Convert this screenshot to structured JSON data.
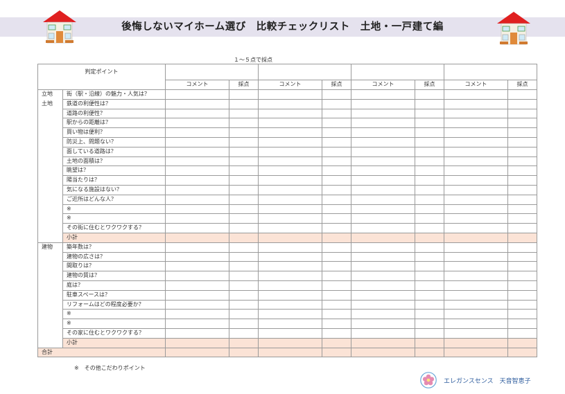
{
  "header": {
    "title": "後悔しないマイホーム選び　比較チェックリスト　土地・一戸建て編",
    "scoring_note": "１～５点で採点"
  },
  "table": {
    "judgment_header": "判定ポイント",
    "candidates": [
      {
        "comment_label": "コメント",
        "score_label": "採点"
      },
      {
        "comment_label": "コメント",
        "score_label": "採点"
      },
      {
        "comment_label": "コメント",
        "score_label": "採点"
      },
      {
        "comment_label": "コメント",
        "score_label": "採点"
      }
    ],
    "sections": [
      {
        "category_lines": [
          "立地",
          "土地"
        ],
        "items": [
          "街（駅・沿線）の魅力・人気は？",
          "鉄道の利便性は？",
          "道路の利便性？",
          "駅からの距離は？",
          "買い物は便利？",
          "防災上、問題ない？",
          "面している道路は？",
          "土地の面積は？",
          "眺望は？",
          "陽当たりは？",
          "気になる施設はない？",
          "ご近所はどんな人？",
          "※",
          "※",
          "その街に住むとワクワクする？"
        ],
        "subtotal_label": "小計"
      },
      {
        "category_lines": [
          "建物"
        ],
        "items": [
          "築年数は？",
          "建物の広さは？",
          "間取りは？",
          "建物の質は？",
          "庭は？",
          "駐車スペースは？",
          "リフォームはどの程度必要か？",
          "※",
          "※",
          "その家に住むとワクワクする？"
        ],
        "subtotal_label": "小計"
      }
    ],
    "total_label": "合計"
  },
  "footnote": "※　その他こだわりポイント",
  "brand": {
    "name": "エレガンスセンス　天音智恵子",
    "icon": "flower-icon"
  },
  "icons": {
    "left": "house-icon",
    "right": "house-icon"
  },
  "colors": {
    "title_band": "#e5e2ee",
    "subtotal_fill": "#fbe3d6",
    "brand_text": "#2e5d9e",
    "house_roof": "#e02020"
  }
}
